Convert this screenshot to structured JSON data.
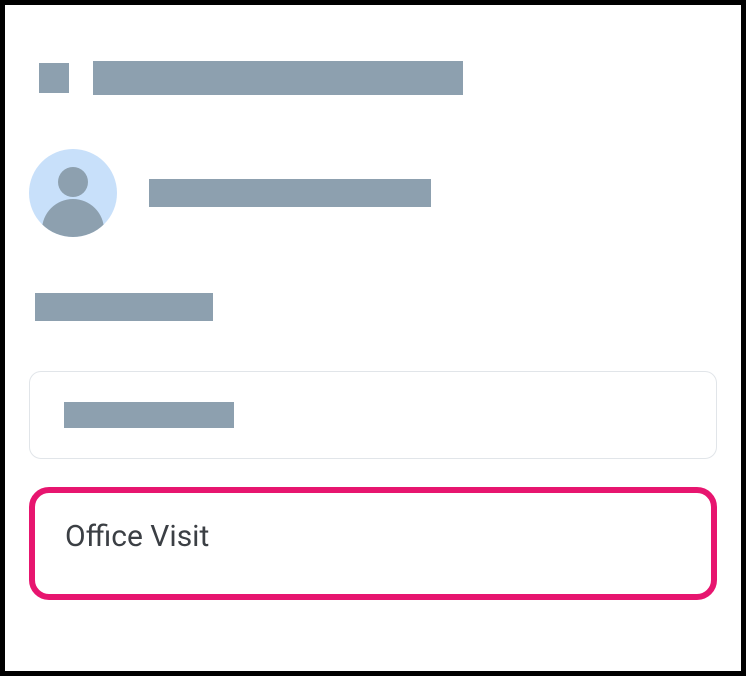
{
  "option": {
    "label": "Office Visit"
  },
  "colors": {
    "placeholder": "#8da0af",
    "avatarBg": "#c8e0fa",
    "highlight": "#e7156f",
    "text": "#3b3f44",
    "fieldBorder": "#e1e5e9"
  }
}
